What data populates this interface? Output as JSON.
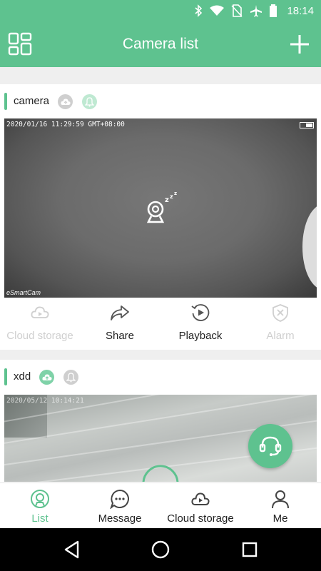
{
  "status": {
    "time": "18:14"
  },
  "header": {
    "title": "Camera list"
  },
  "cameras": [
    {
      "name": "camera",
      "timestamp": "2020/01/16 11:29:59 GMT+08:00",
      "brand": "eSmartCam",
      "actions": [
        {
          "label": "Cloud storage",
          "icon": "cloud-icon",
          "enabled": false
        },
        {
          "label": "Share",
          "icon": "share-icon",
          "enabled": true
        },
        {
          "label": "Playback",
          "icon": "playback-icon",
          "enabled": true
        },
        {
          "label": "Alarm",
          "icon": "alarm-icon",
          "enabled": false
        }
      ]
    },
    {
      "name": "xdd",
      "timestamp": "2020/05/12 10:14:21"
    }
  ],
  "tabs": [
    {
      "label": "List",
      "icon": "list-icon",
      "active": true
    },
    {
      "label": "Message",
      "icon": "message-icon",
      "active": false
    },
    {
      "label": "Cloud storage",
      "icon": "cloud-play-icon",
      "active": false
    },
    {
      "label": "Me",
      "icon": "person-icon",
      "active": false
    }
  ],
  "colors": {
    "accent": "#5ec28f",
    "disabled": "#cfcfcf"
  }
}
